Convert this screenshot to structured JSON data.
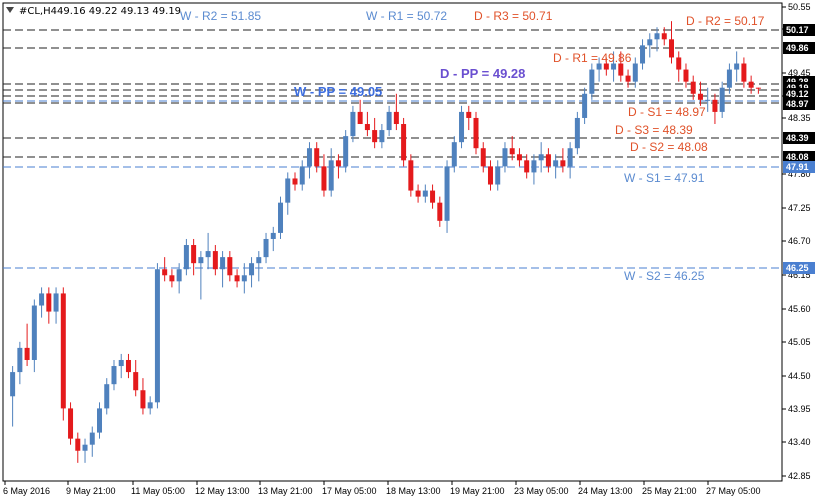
{
  "header": {
    "symbol": "#CL,H4",
    "ohlc": "49.16 49.22 49.13 49.19",
    "icon": "triangle-down-icon"
  },
  "colors": {
    "bull": "#4f81bd",
    "bear": "#e41a1c",
    "weekly_line": "#4a7fd0",
    "weekly_text": "#5b8bd0",
    "weekly_pp_text": "#3e6fe0",
    "daily_line": "#222222",
    "daily_text": "#e0522a",
    "daily_pp_text": "#6a4fd0",
    "price_tag_black": "#000000",
    "price_tag_blue": "#4a7fd0"
  },
  "chart_data": {
    "type": "candlestick",
    "title": "",
    "xlabel": "",
    "ylabel": "",
    "ylim": [
      42.7,
      50.6
    ],
    "grid": false,
    "y_ticks": [
      "50.55",
      "50.00",
      "49.45",
      "48.90",
      "48.35",
      "47.80",
      "47.25",
      "46.70",
      "46.15",
      "45.60",
      "45.05",
      "44.50",
      "43.95",
      "43.40",
      "42.85"
    ],
    "x_labels": [
      "6 May 2016",
      "9 May 21:00",
      "11 May 05:00",
      "12 May 13:00",
      "13 May 21:00",
      "17 May 05:00",
      "18 May 13:00",
      "19 May 21:00",
      "23 May 05:00",
      "24 May 13:00",
      "25 May 21:00",
      "27 May 05:00"
    ],
    "candles": [
      [
        44.1,
        44.6,
        43.6,
        44.5
      ],
      [
        44.5,
        45.0,
        44.3,
        44.9
      ],
      [
        44.9,
        45.3,
        44.6,
        44.7
      ],
      [
        44.7,
        45.7,
        44.5,
        45.6
      ],
      [
        45.6,
        45.9,
        45.4,
        45.8
      ],
      [
        45.8,
        45.9,
        45.3,
        45.5
      ],
      [
        45.5,
        45.9,
        45.3,
        45.8
      ],
      [
        45.8,
        45.9,
        43.7,
        43.9
      ],
      [
        43.9,
        44.0,
        43.3,
        43.4
      ],
      [
        43.4,
        43.5,
        43.0,
        43.2
      ],
      [
        43.2,
        43.4,
        43.0,
        43.3
      ],
      [
        43.3,
        43.6,
        43.1,
        43.5
      ],
      [
        43.5,
        44.0,
        43.4,
        43.9
      ],
      [
        43.9,
        44.4,
        43.8,
        44.3
      ],
      [
        44.3,
        44.7,
        44.2,
        44.6
      ],
      [
        44.6,
        44.8,
        44.4,
        44.7
      ],
      [
        44.7,
        44.8,
        44.4,
        44.5
      ],
      [
        44.5,
        44.7,
        44.1,
        44.2
      ],
      [
        44.2,
        44.4,
        43.8,
        43.9
      ],
      [
        43.9,
        44.1,
        43.8,
        44.0
      ],
      [
        44.0,
        46.3,
        43.9,
        46.2
      ],
      [
        46.2,
        46.4,
        46.0,
        46.1
      ],
      [
        46.1,
        46.2,
        45.9,
        46.0
      ],
      [
        46.0,
        46.3,
        45.8,
        46.2
      ],
      [
        46.2,
        46.7,
        46.1,
        46.6
      ],
      [
        46.6,
        46.7,
        46.1,
        46.3
      ],
      [
        46.3,
        46.5,
        45.7,
        46.4
      ],
      [
        46.4,
        46.8,
        46.2,
        46.5
      ],
      [
        46.5,
        46.6,
        46.1,
        46.2
      ],
      [
        46.2,
        46.5,
        45.9,
        46.4
      ],
      [
        46.4,
        46.5,
        46.0,
        46.1
      ],
      [
        46.1,
        46.2,
        45.9,
        46.0
      ],
      [
        46.0,
        46.3,
        45.8,
        46.1
      ],
      [
        46.1,
        46.4,
        45.9,
        46.3
      ],
      [
        46.3,
        46.5,
        46.0,
        46.4
      ],
      [
        46.4,
        46.8,
        46.3,
        46.7
      ],
      [
        46.7,
        46.9,
        46.5,
        46.8
      ],
      [
        46.8,
        47.4,
        46.7,
        47.3
      ],
      [
        47.3,
        47.8,
        47.1,
        47.7
      ],
      [
        47.7,
        47.8,
        47.5,
        47.6
      ],
      [
        47.6,
        48.0,
        47.5,
        47.9
      ],
      [
        47.9,
        48.3,
        47.7,
        48.2
      ],
      [
        48.2,
        48.3,
        47.8,
        47.9
      ],
      [
        47.9,
        48.1,
        47.4,
        47.5
      ],
      [
        47.5,
        48.2,
        47.4,
        48.0
      ],
      [
        48.0,
        48.1,
        47.7,
        47.9
      ],
      [
        47.9,
        48.5,
        47.8,
        48.4
      ],
      [
        48.4,
        48.9,
        48.3,
        48.8
      ],
      [
        48.8,
        49.0,
        48.6,
        48.6
      ],
      [
        48.6,
        48.8,
        48.4,
        48.5
      ],
      [
        48.5,
        48.7,
        48.2,
        48.3
      ],
      [
        48.3,
        48.6,
        48.2,
        48.5
      ],
      [
        48.5,
        48.9,
        48.4,
        48.8
      ],
      [
        48.8,
        49.1,
        48.5,
        48.6
      ],
      [
        48.6,
        48.7,
        47.9,
        48.0
      ],
      [
        48.0,
        48.1,
        47.4,
        47.5
      ],
      [
        47.5,
        47.6,
        47.3,
        47.4
      ],
      [
        47.4,
        47.6,
        47.3,
        47.5
      ],
      [
        47.5,
        47.6,
        47.2,
        47.3
      ],
      [
        47.3,
        47.4,
        46.9,
        47.0
      ],
      [
        47.0,
        48.0,
        46.8,
        47.9
      ],
      [
        47.9,
        48.4,
        47.8,
        48.3
      ],
      [
        48.3,
        48.9,
        48.2,
        48.8
      ],
      [
        48.8,
        48.9,
        48.5,
        48.7
      ],
      [
        48.7,
        48.8,
        48.1,
        48.2
      ],
      [
        48.2,
        48.3,
        47.8,
        47.9
      ],
      [
        47.9,
        48.0,
        47.5,
        47.6
      ],
      [
        47.6,
        48.0,
        47.5,
        47.9
      ],
      [
        47.9,
        48.3,
        47.8,
        48.2
      ],
      [
        48.2,
        48.4,
        48.0,
        48.1
      ],
      [
        48.1,
        48.2,
        47.9,
        48.0
      ],
      [
        48.0,
        48.1,
        47.7,
        47.8
      ],
      [
        47.8,
        48.1,
        47.6,
        48.0
      ],
      [
        48.0,
        48.3,
        47.8,
        48.1
      ],
      [
        48.1,
        48.2,
        47.8,
        47.9
      ],
      [
        47.9,
        48.1,
        47.7,
        48.0
      ],
      [
        48.0,
        48.2,
        47.8,
        47.9
      ],
      [
        47.9,
        48.3,
        47.7,
        48.2
      ],
      [
        48.2,
        48.8,
        48.1,
        48.7
      ],
      [
        48.7,
        49.2,
        48.6,
        49.1
      ],
      [
        49.1,
        49.6,
        49.0,
        49.5
      ],
      [
        49.5,
        49.7,
        49.3,
        49.6
      ],
      [
        49.6,
        49.7,
        49.4,
        49.5
      ],
      [
        49.5,
        49.8,
        49.3,
        49.6
      ],
      [
        49.6,
        49.8,
        49.3,
        49.4
      ],
      [
        49.4,
        49.5,
        49.2,
        49.3
      ],
      [
        49.3,
        49.7,
        49.2,
        49.6
      ],
      [
        49.6,
        50.0,
        49.5,
        49.9
      ],
      [
        49.9,
        50.1,
        49.7,
        50.0
      ],
      [
        50.0,
        50.2,
        49.8,
        50.1
      ],
      [
        50.1,
        50.2,
        49.9,
        50.0
      ],
      [
        50.0,
        50.3,
        49.6,
        49.7
      ],
      [
        49.7,
        49.8,
        49.3,
        49.5
      ],
      [
        49.5,
        49.6,
        49.2,
        49.3
      ],
      [
        49.3,
        49.4,
        49.0,
        49.1
      ],
      [
        49.1,
        49.3,
        48.9,
        49.0
      ],
      [
        49.0,
        49.2,
        48.8,
        49.0
      ],
      [
        49.0,
        49.1,
        48.6,
        48.8
      ],
      [
        48.8,
        49.3,
        48.7,
        49.2
      ],
      [
        49.2,
        49.6,
        49.1,
        49.5
      ],
      [
        49.5,
        49.8,
        49.3,
        49.6
      ],
      [
        49.6,
        49.7,
        49.2,
        49.3
      ],
      [
        49.3,
        49.4,
        49.1,
        49.2
      ],
      [
        49.2,
        49.2,
        49.1,
        49.19
      ]
    ],
    "levels": [
      {
        "label": "W - R2 = 51.85",
        "value": 51.85,
        "group": "weekly",
        "tag": ""
      },
      {
        "label": "W - R1 = 50.72",
        "value": 50.72,
        "group": "weekly",
        "tag": ""
      },
      {
        "label": "D - R3 = 50.71",
        "value": 50.71,
        "group": "daily",
        "tag": ""
      },
      {
        "label": "D - R2 = 50.17",
        "value": 50.17,
        "group": "daily",
        "tag": "50.17"
      },
      {
        "label": "D - R1 = 49.86",
        "value": 49.86,
        "group": "daily",
        "tag": "49.86"
      },
      {
        "label": "D - PP = 49.28",
        "value": 49.28,
        "group": "daily",
        "tag": "49.28"
      },
      {
        "label": "W - PP = 49.05",
        "value": 49.05,
        "group": "weekly",
        "tag": "49.05"
      },
      {
        "label": "D - S1 = 48.97",
        "value": 48.97,
        "group": "daily",
        "tag": "48.97"
      },
      {
        "label": "D - S3 = 48.39",
        "value": 48.39,
        "group": "daily",
        "tag": "48.39"
      },
      {
        "label": "D - S2 = 48.08",
        "value": 48.08,
        "group": "daily",
        "tag": "48.08"
      },
      {
        "label": "W - S1 = 47.91",
        "value": 47.91,
        "group": "weekly",
        "tag": "47.91"
      },
      {
        "label": "W - S2 = 46.25",
        "value": 46.25,
        "group": "weekly",
        "tag": "46.25"
      }
    ],
    "extra_tags": [
      "49.19",
      "49.12"
    ]
  }
}
